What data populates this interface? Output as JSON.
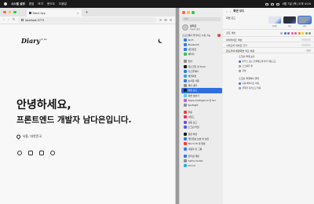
{
  "menubar": {
    "app_name": "시스템 설정",
    "menus": [
      "편집",
      "보기",
      "윈도우",
      "도움말"
    ],
    "clock": "4월 7일 (목) 오후 4:04"
  },
  "browser": {
    "tab_title": "React App",
    "url": "localhost:3773",
    "logo_text": "Diary",
    "logo_sub": "by me",
    "hero_line1": "안녕하세요,",
    "hero_line2": "프론트엔드 개발자 남다은입니다.",
    "location": "서울, 대한민국",
    "socials": [
      "github-icon",
      "linkedin-icon",
      "instagram-icon",
      "blog-icon"
    ]
  },
  "settings_sidebar": {
    "search_placeholder": "검색",
    "account_name": "남다은",
    "account_sub": "Apple 계정",
    "notice": "소프트웨어 업데이트 사용 가능",
    "notice_count": "1",
    "groups": [
      [
        {
          "label": "Wi-Fi",
          "color": "#2f7bf5"
        },
        {
          "label": "Bluetooth",
          "color": "#2f7bf5"
        },
        {
          "label": "네트워크",
          "color": "#2f7bf5"
        },
        {
          "label": "배터리",
          "color": "#34c759"
        }
      ],
      [
        {
          "label": "일반",
          "color": "#8e8e93"
        },
        {
          "label": "데스크탑 및 Dock",
          "color": "#1c1c1e"
        },
        {
          "label": "디스플레이",
          "color": "#2f7bf5"
        },
        {
          "label": "배경화면",
          "color": "#35aadc"
        },
        {
          "label": "손쉬운 사용",
          "color": "#2f7bf5"
        },
        {
          "label": "제어 센터",
          "color": "#8e8e93"
        },
        {
          "label": "화면 모드",
          "color": "#1c1c1e",
          "selected": true
        },
        {
          "label": "화면 보호기",
          "color": "#5ac8fa"
        },
        {
          "label": "Apple Intelligence 및 Siri",
          "color": "#bf5af2"
        },
        {
          "label": "Spotlight",
          "color": "#8e8e93"
        }
      ],
      [
        {
          "label": "알림",
          "color": "#ff3b30"
        },
        {
          "label": "사운드",
          "color": "#ff2d55"
        },
        {
          "label": "집중 모드",
          "color": "#5e5ce6"
        },
        {
          "label": "스크린 타임",
          "color": "#5e5ce6"
        }
      ],
      [
        {
          "label": "잠금 화면",
          "color": "#1c1c1e"
        },
        {
          "label": "개인정보 보호 및 보안",
          "color": "#2f7bf5"
        },
        {
          "label": "Touch ID 및 암호",
          "color": "#ff3b30"
        },
        {
          "label": "사용자 및 그룹",
          "color": "#2f7bf5"
        }
      ],
      [
        {
          "label": "인터넷 계정",
          "color": "#2f7bf5"
        },
        {
          "label": "Game Center",
          "color": "#8e8e93"
        },
        {
          "label": "iCloud",
          "color": "#35aadc"
        }
      ]
    ]
  },
  "settings_main": {
    "title": "화면 모드",
    "appearance_label": "화면 모드",
    "appearance_options": [
      {
        "label": "라이트",
        "bg": "#dfe6ee",
        "accent": "#2f6fe0"
      },
      {
        "label": "다크",
        "bg": "#2b2f3a",
        "accent": "#4a6fd0"
      },
      {
        "label": "자동",
        "bg": "#8f9db3",
        "accent": "#2f6fe0",
        "selected": true
      }
    ],
    "accent_label": "강조 색상",
    "accent_colors": [
      "#b0b0b0",
      "#2f6fe0",
      "#a550a7",
      "#f74f9e",
      "#ff5257",
      "#f7821b",
      "#ffc600",
      "#62ba46",
      "#8c8c8c"
    ],
    "highlight_label": "하이라이트 색상",
    "sidebar_icon_label": "사이드바 아이콘 크기",
    "wallpaper_tint_label": "윈도우에 배경화면 색조 허용",
    "scrollbar_label": "스크롤 막대 보기",
    "scrollbar_options": [
      "마우스 또는 트랙패드에 따라 자동으로",
      "스크롤할 때",
      "항상"
    ],
    "click_label": "스크롤 막대에서 클릭",
    "click_options": [
      "다음 페이지로 이동",
      "클릭한 지점으로 이동"
    ]
  }
}
